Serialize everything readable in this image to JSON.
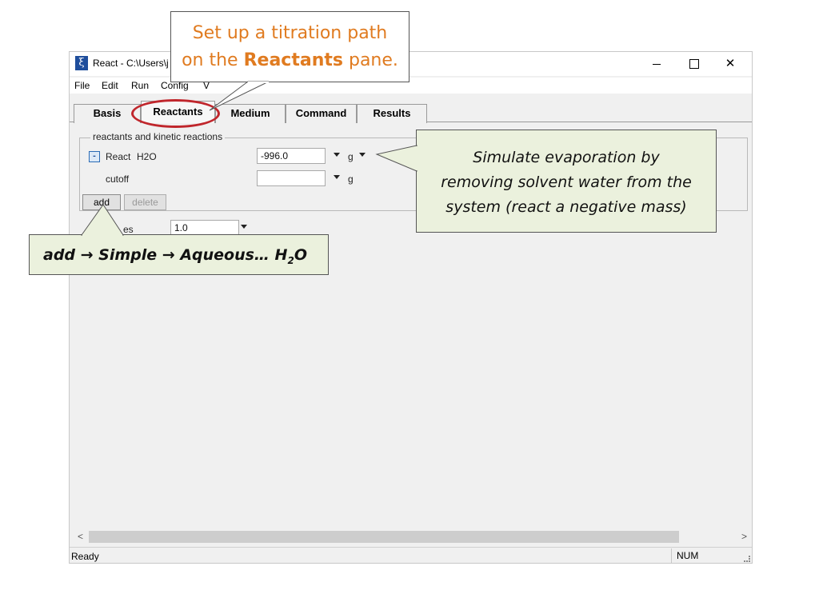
{
  "window": {
    "title": "React - C:\\Users\\j",
    "controls": {
      "minimize_icon": "minimize-icon",
      "maximize_icon": "maximize-icon",
      "close": "✕"
    }
  },
  "menu": {
    "file": "File",
    "edit": "Edit",
    "run": "Run",
    "config": "Config",
    "view": "V"
  },
  "tabs": [
    "Basis",
    "Reactants",
    "Medium",
    "Command",
    "Results"
  ],
  "reactants": {
    "group_title": "reactants and kinetic reactions",
    "remove_button": "-",
    "react_label": "React",
    "species": "H2O",
    "mass_value": "-996.0",
    "mass_unit": "g",
    "cutoff_label": "cutoff",
    "cutoff_value": "",
    "cutoff_unit": "g",
    "add_button": "add",
    "delete_button": "delete",
    "delxi_label_partial": "es",
    "delxi_value": "1.0"
  },
  "scrollbar": {
    "left": "<",
    "right": ">"
  },
  "status": {
    "text": "Ready",
    "num": "NUM"
  },
  "callouts": {
    "titration_before": "Set up a titration path",
    "titration_on_the": "on the ",
    "titration_strong": "Reactants",
    "titration_after": " pane.",
    "evaporation_line1": "Simulate evaporation by",
    "evaporation_line2": "removing solvent water from the",
    "evaporation_line3": "system (react a negative mass)",
    "add_path": "add → Simple → Aqueous… H",
    "add_path_subscript": "2",
    "add_path_end": "O"
  },
  "colors": {
    "highlight_ring": "#c0262c",
    "callout_orange": "#e07b20",
    "callout_green_bg": "#ebf1dd"
  }
}
